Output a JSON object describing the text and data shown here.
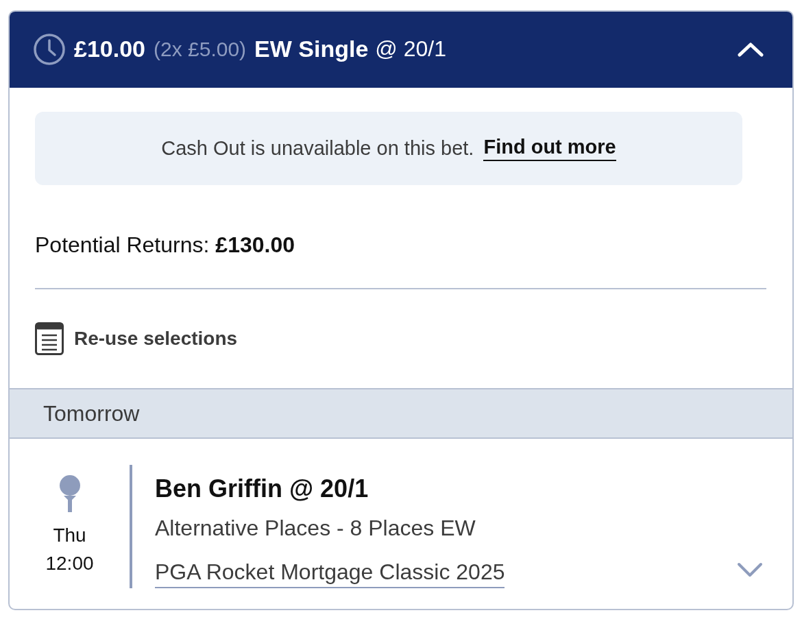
{
  "bet": {
    "stake": "£10.00",
    "stake_breakdown": "(2x £5.00)",
    "bet_type": "EW Single",
    "odds": "@ 20/1",
    "expanded": true
  },
  "cash_out_notice": {
    "message": "Cash Out is unavailable on this bet.",
    "link": "Find out more"
  },
  "potential_returns": {
    "label": "Potential Returns:",
    "amount": "£130.00"
  },
  "reuse_selections": {
    "label": "Re-use selections"
  },
  "date_header": "Tomorrow",
  "selections": [
    {
      "day": "Thu",
      "time": "12:00",
      "title": "Ben Griffin @ 20/1",
      "market": "Alternative Places - 8 Places EW",
      "event": "PGA Rocket Mortgage Classic 2025",
      "expanded": false
    }
  ]
}
